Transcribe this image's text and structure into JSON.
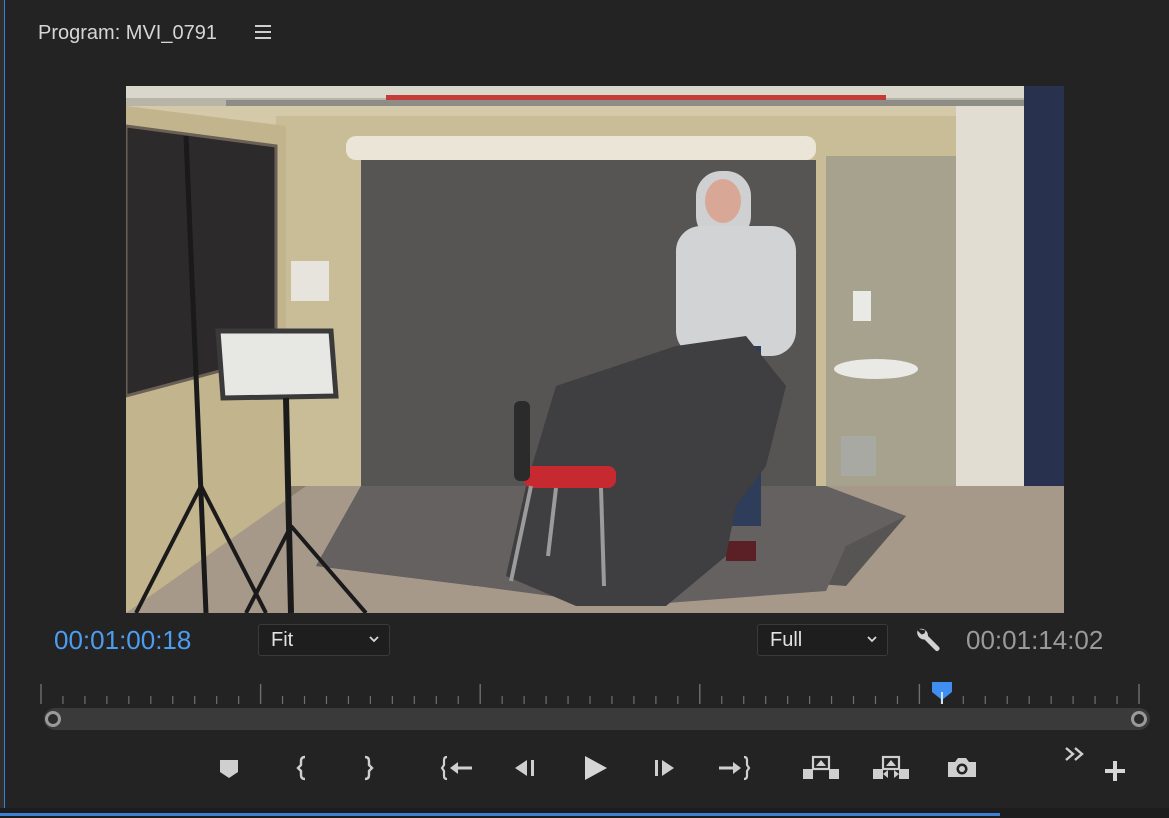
{
  "panel": {
    "title": "Program: MVI_0791",
    "menu_icon": "hamburger-menu-icon"
  },
  "monitor": {
    "current_timecode": "00:01:00:18",
    "duration_timecode": "00:01:14:02",
    "zoom_select": {
      "value": "Fit"
    },
    "resolution_select": {
      "value": "Full"
    },
    "settings_icon": "wrench-icon",
    "playhead_fraction": 0.82
  },
  "transport": [
    {
      "name": "add-marker-button",
      "icon": "marker-icon"
    },
    {
      "name": "mark-in-button",
      "icon": "mark-in-icon"
    },
    {
      "name": "mark-out-button",
      "icon": "mark-out-icon"
    },
    {
      "name": "go-to-in-button",
      "icon": "go-to-in-icon"
    },
    {
      "name": "step-back-button",
      "icon": "step-back-icon"
    },
    {
      "name": "play-button",
      "icon": "play-icon"
    },
    {
      "name": "step-forward-button",
      "icon": "step-forward-icon"
    },
    {
      "name": "go-to-out-button",
      "icon": "go-to-out-icon"
    },
    {
      "name": "lift-button",
      "icon": "lift-icon"
    },
    {
      "name": "extract-button",
      "icon": "extract-icon"
    },
    {
      "name": "export-frame-button",
      "icon": "camera-icon"
    },
    {
      "name": "more-controls-button",
      "icon": "double-chevron-icon"
    },
    {
      "name": "button-editor-button",
      "icon": "plus-icon"
    }
  ],
  "colors": {
    "accent": "#4c9df1",
    "panel_bg": "#232323"
  }
}
